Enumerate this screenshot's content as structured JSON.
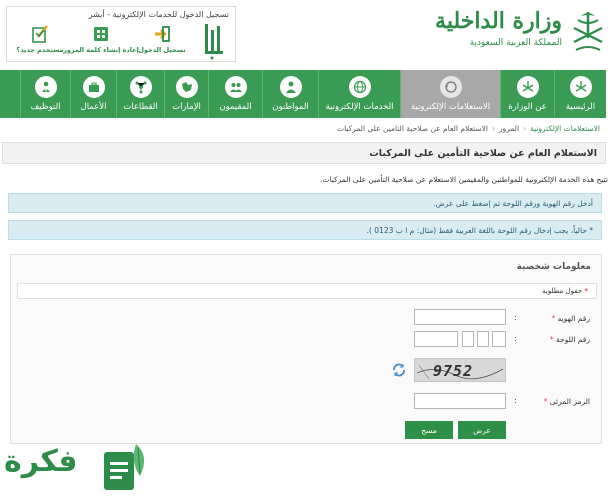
{
  "header": {
    "ministry_title": "وزارة الداخلية",
    "ministry_subtitle": "المملكة العربية السعودية",
    "absher_title": "تسجيل الدخول للخدمات الإلكترونية - أبشر",
    "absher_actions": [
      {
        "label": "مستخدم جديد؟",
        "icon": "new-user-icon"
      },
      {
        "label": "إعادة إنشاء كلمة المرور",
        "icon": "reset-password-icon"
      },
      {
        "label": "تسجيل الدخول",
        "icon": "login-icon"
      }
    ]
  },
  "nav": {
    "items": [
      {
        "label": "الرئيسية",
        "icon": "emblem-icon",
        "active": false
      },
      {
        "label": "عن الوزارة",
        "icon": "emblem-icon",
        "active": false
      },
      {
        "label": "الاستعلامات الإلكترونية",
        "icon": "inquiry-icon",
        "active": true
      },
      {
        "label": "الخدمات الإلكترونية",
        "icon": "globe-icon",
        "active": false
      },
      {
        "label": "المواطنون",
        "icon": "citizen-icon",
        "active": false
      },
      {
        "label": "المقيمون",
        "icon": "residents-icon",
        "active": false
      },
      {
        "label": "الإمارات",
        "icon": "map-icon",
        "active": false
      },
      {
        "label": "القطاعات",
        "icon": "sectors-icon",
        "active": false
      },
      {
        "label": "الأعمال",
        "icon": "briefcase-icon",
        "active": false
      },
      {
        "label": "التوظيف",
        "icon": "employment-icon",
        "active": false
      }
    ]
  },
  "breadcrumb": {
    "items": [
      "الاستعلامات الإلكترونية",
      "المرور",
      "الاستعلام العام عن صلاحية التامين على المركبات"
    ]
  },
  "page": {
    "title": "الاستعلام العام عن صلاحية التأمين على المركبات",
    "intro": "تتيح هذه الخدمة الإلكترونية للمواطنين والمقيمين الاستعلام عن صلاحية التأمين على المركبات.",
    "info_1": "أدخل رقم الهوية ورقم اللوحة ثم إضغط على عرض.",
    "info_2": "* حالياً، يجب إدخال رقم اللوحة باللغة العربية فقط (مثال: م ا ب 0123 )."
  },
  "form": {
    "heading": "معلومات شخصية",
    "required_note": "حقول مطلوبة",
    "id_label": "رقم الهويه",
    "plate_label": "رقم اللوحة",
    "captcha_label": "الرمز المرئى",
    "captcha_text": "9752",
    "submit_label": "عرض",
    "clear_label": "مسح"
  },
  "watermark": {
    "text": "فكرة"
  },
  "colors": {
    "brand_green": "#3a9c54",
    "active_nav": "#a8a8a8",
    "info_bg": "#d9ecf2",
    "required": "#d9534f"
  }
}
